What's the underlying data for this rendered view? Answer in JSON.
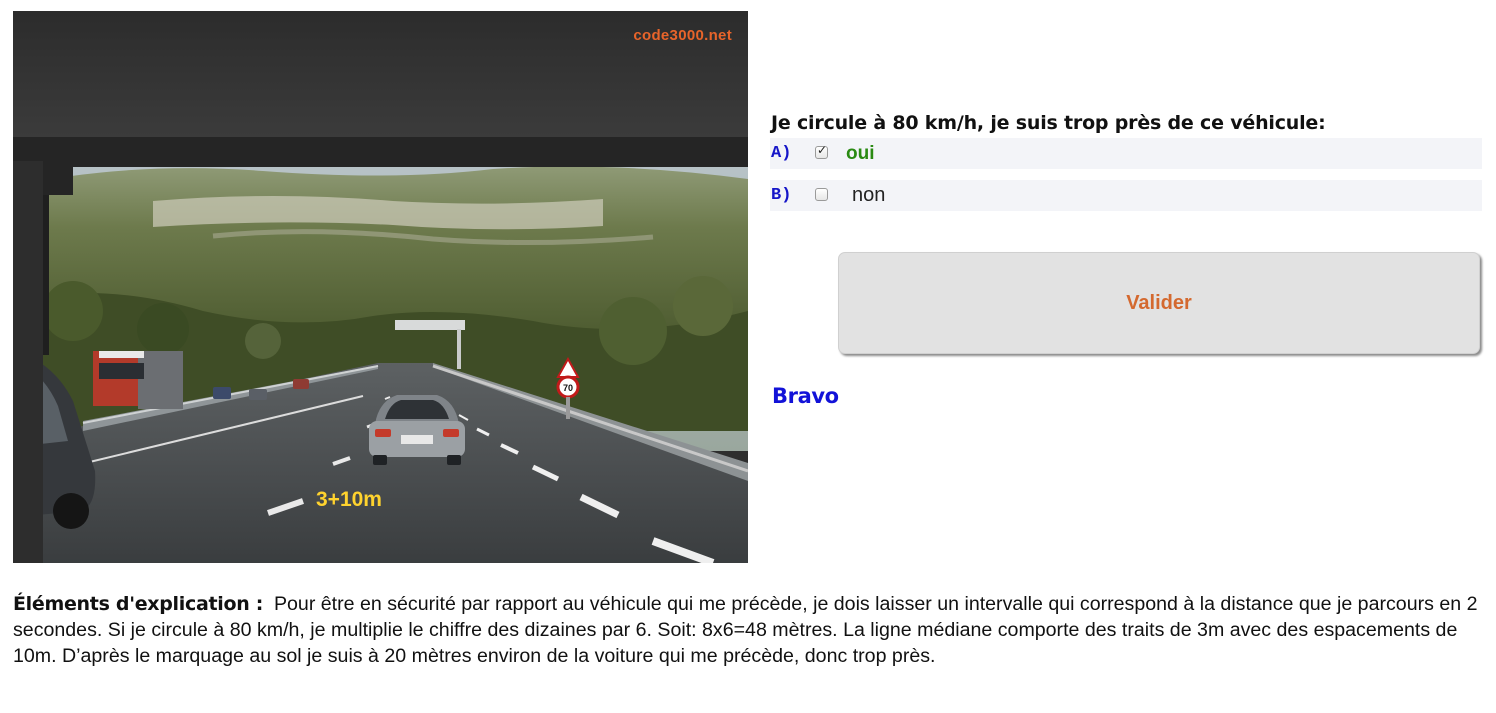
{
  "photo": {
    "watermark": "code3000.net",
    "overlay_text": "3+10m",
    "speed_sign": "70"
  },
  "question": {
    "title": "Je circule à 80 km/h, je suis trop près de ce véhicule:",
    "answers": [
      {
        "letter": "A)",
        "text": "oui",
        "checked": true,
        "status": "correct"
      },
      {
        "letter": "B)",
        "text": "non",
        "checked": false,
        "status": "neutral"
      }
    ]
  },
  "actions": {
    "validate_label": "Valider"
  },
  "feedback": {
    "text": "Bravo"
  },
  "explanation": {
    "label": "Éléments d'explication :",
    "text": "Pour être en sécurité par rapport au véhicule qui me précède, je dois laisser un intervalle qui correspond à la distance que je parcours en 2 secondes. Si je circule à 80 km/h, je multiplie le chiffre des dizaines par 6. Soit: 8x6=48 mètres. La ligne médiane comporte des traits de 3m avec des espacements de 10m. D’après le marquage au sol je suis à 20 mètres environ de la voiture qui me précède, donc trop près."
  },
  "colors": {
    "letter_blue": "#1515c8",
    "correct_green": "#2a8a13",
    "validate_orange": "#d4692f",
    "feedback_blue": "#1212d8",
    "watermark_orange": "#e8642a",
    "overlay_yellow": "#ffd32e"
  }
}
